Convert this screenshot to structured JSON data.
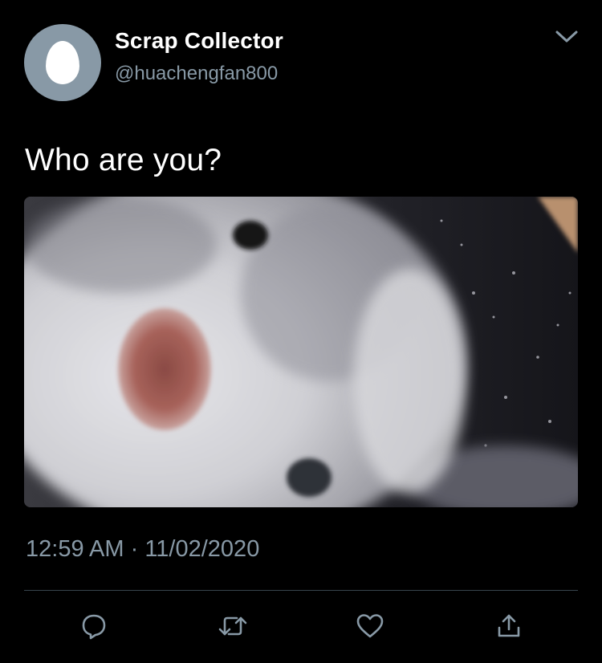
{
  "tweet": {
    "display_name": "Scrap Collector",
    "handle": "@huachengfan800",
    "text": "Who are you?",
    "time": "12:59 AM",
    "separator": "·",
    "date": "11/02/2020",
    "media_description_icon": "photo-of-cat"
  },
  "icons": {
    "menu": "chevron-down-icon",
    "reply": "reply-icon",
    "retweet": "retweet-icon",
    "like": "heart-icon",
    "share": "share-icon"
  },
  "colors": {
    "background": "#000000",
    "text": "#ffffff",
    "secondary": "#8899a6",
    "divider": "#38444d",
    "avatar": "#8899a6"
  }
}
